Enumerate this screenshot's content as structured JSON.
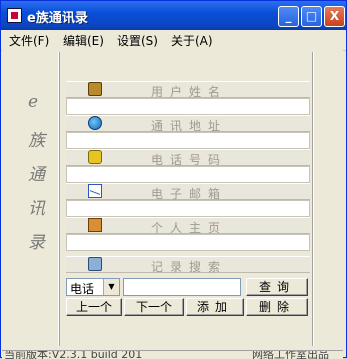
{
  "window": {
    "title": "e族通讯录",
    "controls": {
      "minimize": "_",
      "maximize": "□",
      "close": "X"
    }
  },
  "menu": {
    "items": [
      "文件(F)",
      "编辑(E)",
      "设置(S)",
      "关于(A)"
    ]
  },
  "sidebar": {
    "chars": [
      "e",
      "族",
      "通",
      "讯",
      "录"
    ]
  },
  "fields": [
    {
      "label": "用户姓名",
      "icon": "user-icon"
    },
    {
      "label": "通讯地址",
      "icon": "address-icon"
    },
    {
      "label": "电话号码",
      "icon": "phone-icon"
    },
    {
      "label": "电子邮箱",
      "icon": "mail-icon"
    },
    {
      "label": "个人主页",
      "icon": "home-icon"
    },
    {
      "label": "记录搜索",
      "icon": "search-icon"
    }
  ],
  "search": {
    "selected": "电话",
    "query_label": "查询"
  },
  "buttons": {
    "prev": "上一个",
    "next": "下一个",
    "add": "添加",
    "delete": "删除"
  },
  "status": {
    "left": "当前版本:V2.3.1 build 201",
    "right": "网络工作室出品"
  }
}
